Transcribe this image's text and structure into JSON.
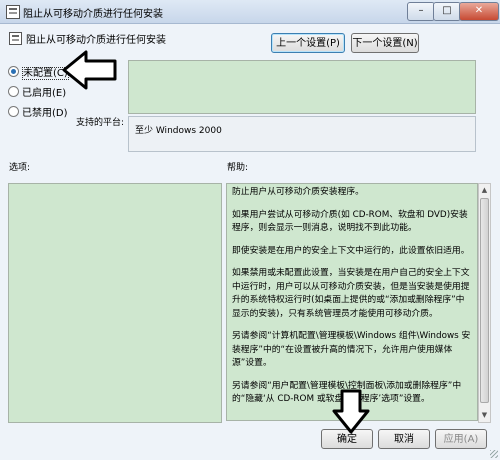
{
  "window": {
    "title": "阻止从可移动介质进行任何安装",
    "minimize_glyph": "–",
    "maximize_glyph": "□",
    "close_glyph": "✕"
  },
  "policy": {
    "name": "阻止从可移动介质进行任何安装",
    "icon": "policy-icon"
  },
  "nav": {
    "prev_label": "上一个设置(P)",
    "next_label": "下一个设置(N)"
  },
  "state": {
    "options": [
      {
        "label": "未配置(C)",
        "checked": true
      },
      {
        "label": "已启用(E)",
        "checked": false
      },
      {
        "label": "已禁用(D)",
        "checked": false
      }
    ]
  },
  "platform": {
    "label": "支持的平台:",
    "value": "至少 Windows 2000"
  },
  "options_label": "选项:",
  "help_label": "帮助:",
  "help_paragraphs": [
    "防止用户从可移动介质安装程序。",
    "如果用户尝试从可移动介质(如 CD-ROM、软盘和 DVD)安装程序，则会显示一则消息，说明找不到此功能。",
    "即使安装是在用户的安全上下文中运行的，此设置依旧适用。",
    "如果禁用或未配置此设置，当安装是在用户自己的安全上下文中运行时，用户可以从可移动介质安装，但是当安装是使用提升的系统特权运行时(如桌面上提供的或“添加或删除程序”中显示的安装)，只有系统管理员才能使用可移动介质。",
    "另请参阅“计算机配置\\管理模板\\Windows 组件\\Windows 安装程序”中的“在设置被升高的情况下，允许用户使用媒体源”设置。",
    "另请参阅“用户配置\\管理模板\\控制面板\\添加或删除程序”中的“隐藏‘从 CD-ROM 或软盘添加程序’选项”设置。"
  ],
  "buttons": {
    "ok": "确定",
    "cancel": "取消",
    "apply": "应用(A)"
  },
  "colors": {
    "green_panel": "#cfe7cf",
    "window_bg": "#eef3f9",
    "close_button": "#c74a33"
  }
}
